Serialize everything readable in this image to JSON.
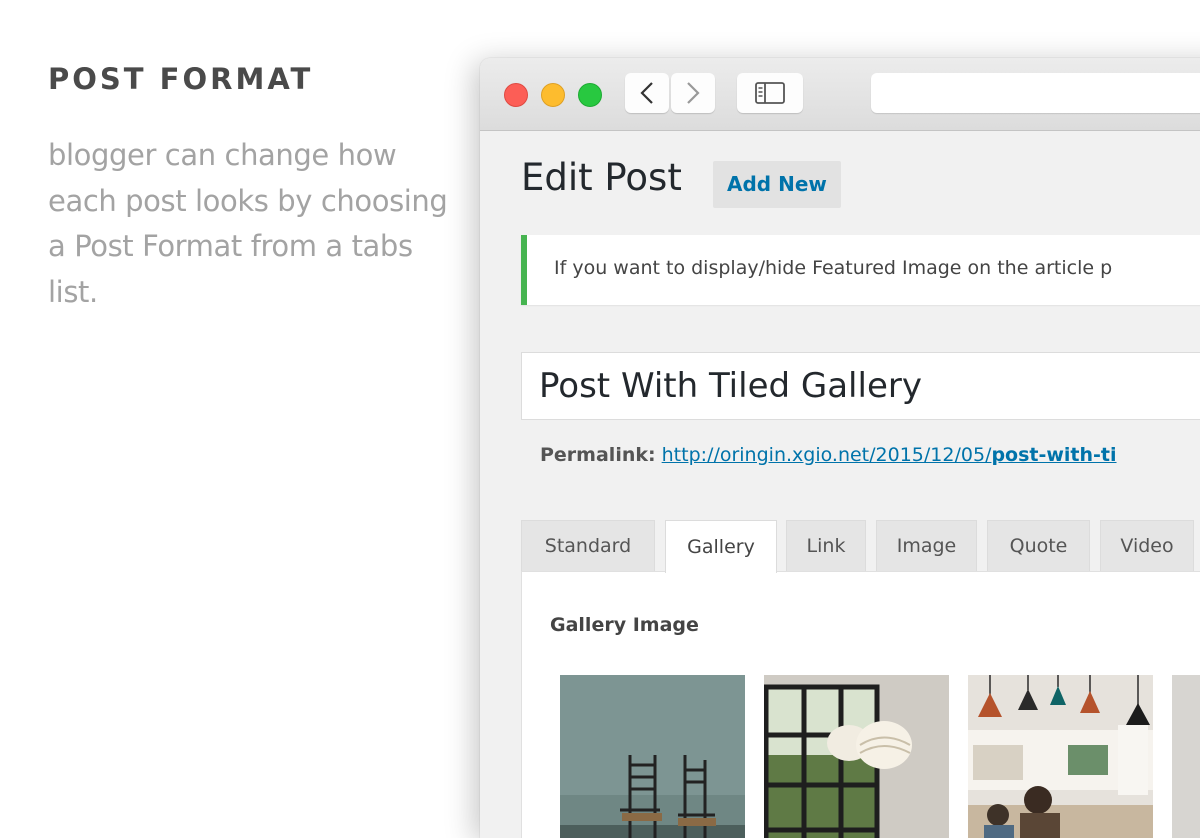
{
  "promo": {
    "heading": "POST FORMAT",
    "body": "blogger can change how each post looks by choosing a Post Format from a tabs list."
  },
  "browser": {
    "traffic_lights": [
      "#fc5e56",
      "#fdbc2e",
      "#28c840"
    ],
    "icons": [
      "chevron-left-icon",
      "chevron-right-icon",
      "sidebar-icon"
    ]
  },
  "editor": {
    "page_title": "Edit Post",
    "add_new_label": "Add New",
    "notice": "If you want to display/hide Featured Image on the article p",
    "post_title": "Post With Tiled Gallery",
    "permalink": {
      "label": "Permalink:",
      "url_base": "http://oringin.xgio.net/2015/12/05/",
      "slug": "post-with-ti"
    },
    "format_tabs": [
      "Standard",
      "Gallery",
      "Link",
      "Image",
      "Quote",
      "Video"
    ],
    "active_tab": "Gallery",
    "gallery_heading": "Gallery Image",
    "accent_color": "#0073aa",
    "notice_color": "#46b450"
  }
}
